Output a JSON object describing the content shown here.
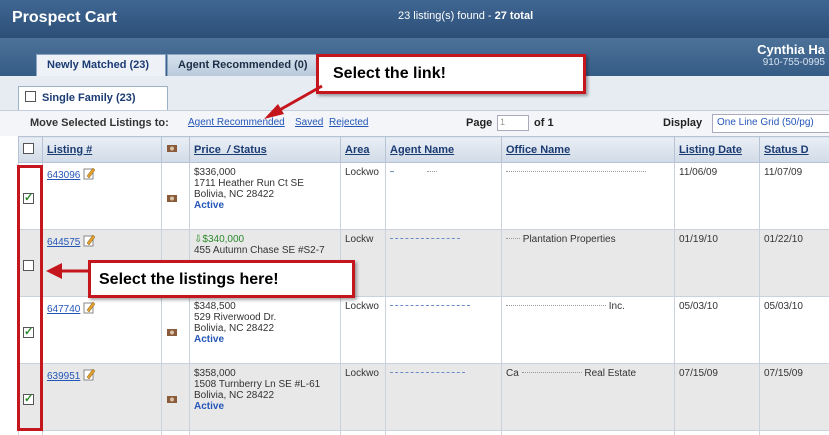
{
  "header": {
    "title": "Prospect Cart",
    "found_prefix": "23 listing(s) found - ",
    "found_total": "27 total"
  },
  "tabs": [
    {
      "label": "Newly Matched (23)"
    },
    {
      "label": "Agent Recommended (0)"
    }
  ],
  "user": {
    "name": "Cynthia Ha",
    "phone": "910-755-0995"
  },
  "subtab": {
    "label": "Single Family (23)"
  },
  "movebar": {
    "label": "Move Selected Listings to:",
    "links": [
      "Agent Recommended",
      "Saved",
      "Rejected"
    ],
    "page_label": "Page",
    "page_value": "1",
    "of_label": "of 1",
    "display_label": "Display",
    "display_value": "One Line Grid (50/pg)"
  },
  "columns": {
    "listing": "Listing #",
    "price": "Price",
    "sort_sep": "/",
    "status": "Status",
    "area": "Area",
    "agent": "Agent Name",
    "office": "Office Name",
    "listing_date": "Listing Date",
    "status_date": "Status D"
  },
  "rows": [
    {
      "listing": "643096",
      "price": "$336,000",
      "address": "1711 Heather Run Ct SE",
      "city": "Bolivia, NC 28422",
      "status": "Active",
      "area": "Lockwo",
      "office": "...",
      "listing_date": "11/06/09",
      "status_date": "11/07/09",
      "checked": true
    },
    {
      "listing": "644575",
      "price": "$340,000",
      "address": "455 Autumn Chase SE #S2-7",
      "city": "",
      "status": "",
      "area": "Lockw",
      "office": "Plantation Properties",
      "listing_date": "01/19/10",
      "status_date": "01/22/10",
      "checked": false
    },
    {
      "listing": "647740",
      "price": "$348,500",
      "address": "529 Riverwood Dr.",
      "city": "Bolivia, NC 28422",
      "status": "Active",
      "area": "Lockwo",
      "office": "Inc.",
      "listing_date": "05/03/10",
      "status_date": "05/03/10",
      "checked": true
    },
    {
      "listing": "639951",
      "price": "$358,000",
      "address": "1508 Turnberry Ln SE #L-61",
      "city": "Bolivia, NC 28422",
      "status": "Active",
      "area": "Lockwo",
      "office": "Real Estate",
      "listing_date": "07/15/09",
      "status_date": "07/15/09",
      "checked": true
    }
  ],
  "callouts": {
    "link": "Select the link!",
    "listings": "Select the listings here!"
  },
  "colors": {
    "annotation_red": "#c4161c",
    "link_blue": "#2456b8",
    "header_blue": "#2c4f78"
  }
}
